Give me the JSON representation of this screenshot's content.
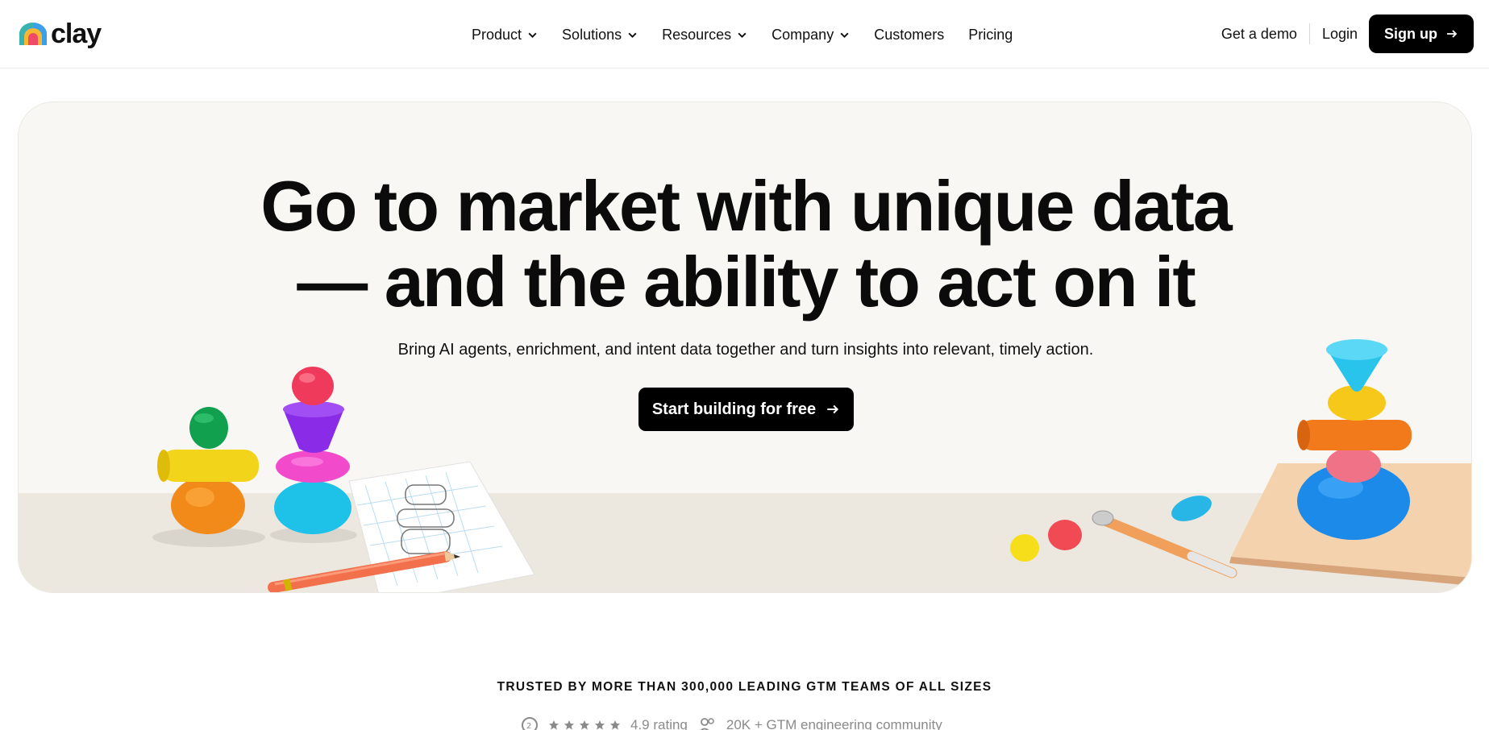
{
  "brand": {
    "name": "clay"
  },
  "nav": {
    "items": [
      {
        "label": "Product",
        "dropdown": true
      },
      {
        "label": "Solutions",
        "dropdown": true
      },
      {
        "label": "Resources",
        "dropdown": true
      },
      {
        "label": "Company",
        "dropdown": true
      },
      {
        "label": "Customers",
        "dropdown": false
      },
      {
        "label": "Pricing",
        "dropdown": false
      }
    ],
    "demo_label": "Get a demo",
    "login_label": "Login",
    "signup_label": "Sign up"
  },
  "hero": {
    "headline_line1": "Go to market with unique data",
    "headline_line2": "— and the ability to act on it",
    "subheadline": "Bring AI agents, enrichment, and intent data together and turn insights into relevant, timely action.",
    "cta_label": "Start building for free"
  },
  "trust": {
    "text": "TRUSTED BY MORE THAN 300,000 LEADING GTM TEAMS OF ALL SIZES",
    "rating_text": "4.9 rating",
    "rating_value": 4.9,
    "community_text": "20K + GTM engineering community"
  },
  "colors": {
    "accent": "#000000",
    "hero_bg": "#f8f7f4",
    "floor": "#ece8df"
  },
  "icons": [
    "clay-logo-icon",
    "chevron-down-icon",
    "arrow-right-icon",
    "g2-icon",
    "star-icon",
    "community-icon"
  ]
}
